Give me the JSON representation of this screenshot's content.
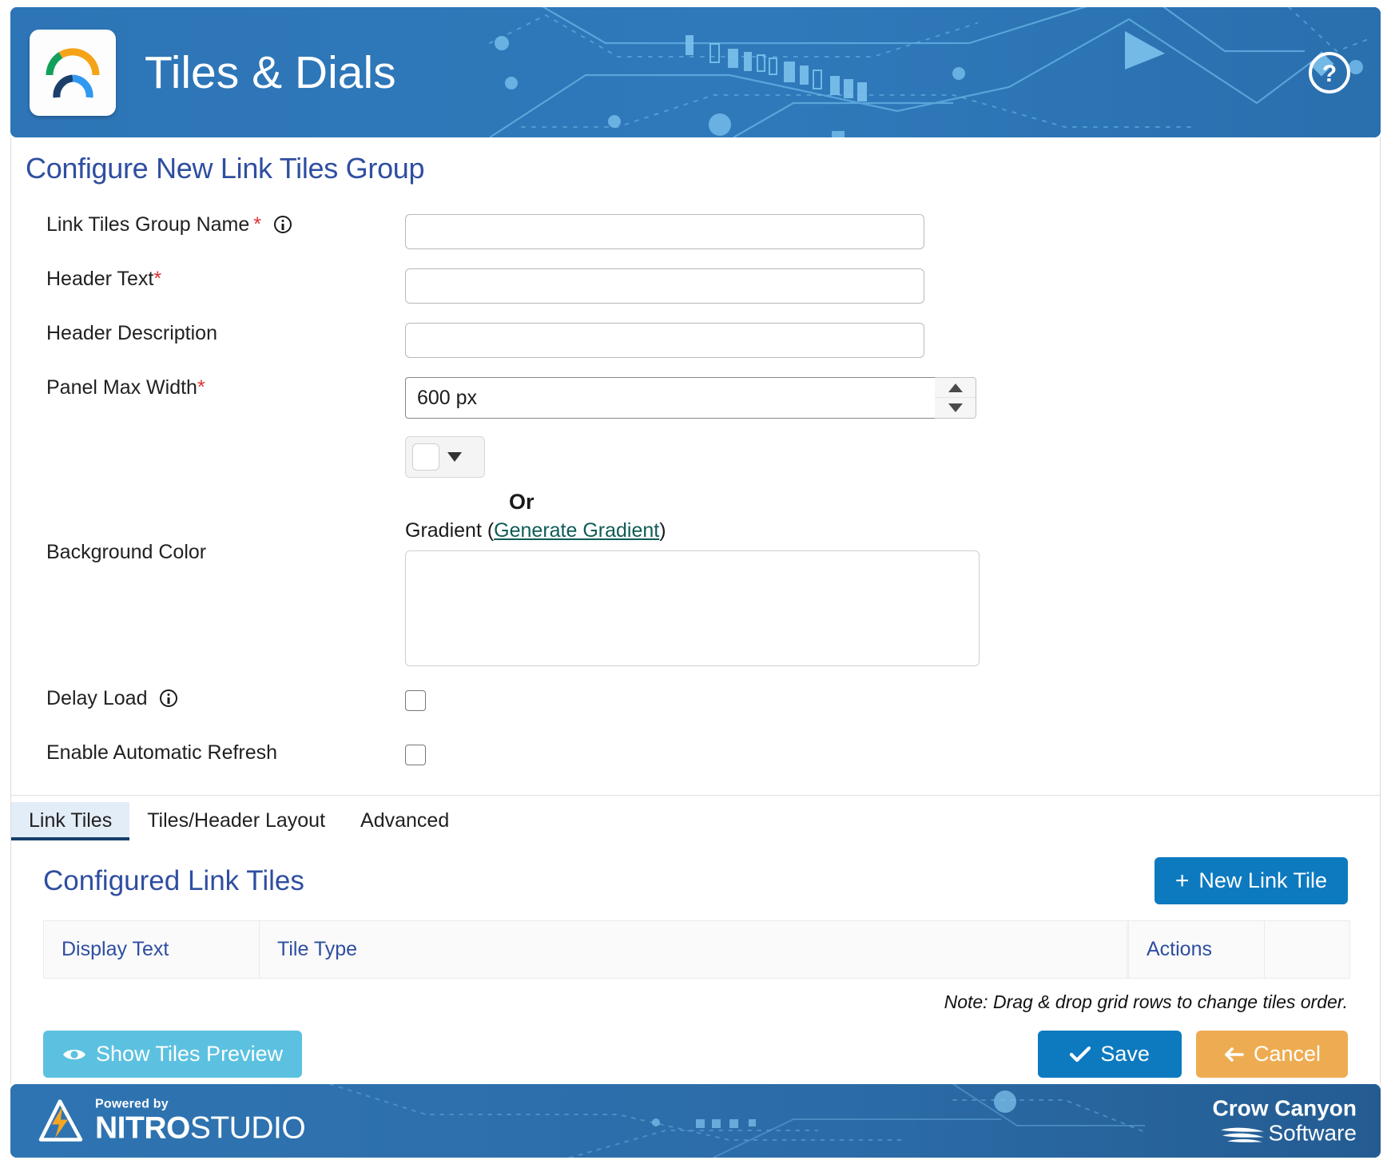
{
  "header": {
    "app_title": "Tiles & Dials",
    "logo_icon": "gauge-dial-icon",
    "help_icon": "question-circle-icon",
    "bg_color": "#2d75b6"
  },
  "page": {
    "section_title": "Configure New Link Tiles Group"
  },
  "form": {
    "group_name": {
      "label": "Link Tiles Group Name",
      "required_mark": "*",
      "info_icon": "info-icon",
      "value": "",
      "placeholder": ""
    },
    "header_text": {
      "label": "Header Text",
      "required_mark": "*",
      "value": "",
      "placeholder": ""
    },
    "header_description": {
      "label": "Header Description",
      "value": "",
      "placeholder": ""
    },
    "panel_max_width": {
      "label": "Panel Max Width",
      "required_mark": "*",
      "value": "600 px",
      "spinner_up_icon": "triangle-up-icon",
      "spinner_down_icon": "triangle-down-icon"
    },
    "background_color": {
      "label": "Background Color",
      "swatch_color": "#ffffff",
      "dropdown_icon": "chevron-down-icon",
      "or_text": "Or",
      "gradient_label_prefix": "Gradient (",
      "gradient_link": "Generate Gradient",
      "gradient_label_suffix": ")",
      "gradient_value": "",
      "gradient_placeholder": ""
    },
    "delay_load": {
      "label": "Delay Load",
      "info_icon": "info-icon",
      "checked": false
    },
    "auto_refresh": {
      "label": "Enable Automatic Refresh",
      "checked": false
    }
  },
  "tabs": [
    {
      "label": "Link Tiles",
      "active": true
    },
    {
      "label": "Tiles/Header Layout",
      "active": false
    },
    {
      "label": "Advanced",
      "active": false
    }
  ],
  "tiles_panel": {
    "title": "Configured Link Tiles",
    "new_tile_button": "New Link Tile",
    "new_tile_icon": "plus-icon",
    "columns": [
      "Display Text",
      "Tile Type",
      "",
      "Actions",
      ""
    ],
    "rows": [],
    "note": "Note: Drag & drop grid rows to change tiles order."
  },
  "actions": {
    "preview_label": "Show Tiles Preview",
    "preview_icon": "eye-icon",
    "save_label": "Save",
    "save_icon": "check-icon",
    "cancel_label": "Cancel",
    "cancel_icon": "arrow-left-icon"
  },
  "footer": {
    "powered_by": "Powered by",
    "nitro_bold": "NITRO",
    "nitro_light": "STUDIO",
    "nitro_icon": "lightning-bolt-icon",
    "crow_line1": "Crow Canyon",
    "crow_line2": "Software",
    "crow_icon": "wave-icon",
    "bg_color": "#2d6ca8"
  },
  "colors": {
    "accent_blue": "#0d7ac0",
    "title_blue": "#2e4ea0",
    "cancel_orange": "#eeac52",
    "preview_cyan": "#5cc1e0",
    "link_teal": "#0f5c57",
    "required_red": "#e03131"
  }
}
